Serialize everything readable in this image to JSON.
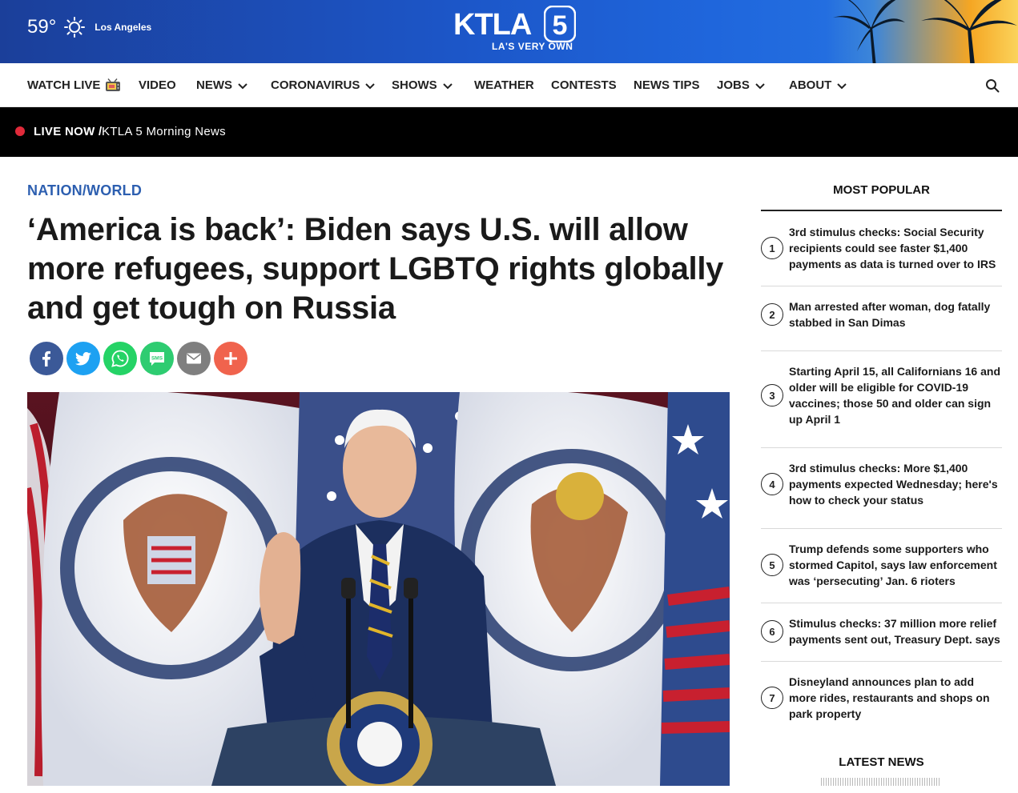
{
  "header": {
    "temperature": "59°",
    "weather_icon": "sun-icon",
    "city": "Los Angeles",
    "logo_text": "KTLA",
    "logo_number": "5",
    "tagline": "LA'S VERY OWN"
  },
  "nav": {
    "items": [
      {
        "label": "WATCH LIVE",
        "icon": "tv-icon"
      },
      {
        "label": "VIDEO"
      },
      {
        "label": "NEWS",
        "icon": "chevron-down-icon"
      },
      {
        "label": "CORONAVIRUS",
        "icon": "chevron-down-icon"
      },
      {
        "label": "SHOWS",
        "icon": "chevron-down-icon"
      },
      {
        "label": "WEATHER"
      },
      {
        "label": "CONTESTS"
      },
      {
        "label": "NEWS TIPS"
      },
      {
        "label": "JOBS",
        "icon": "chevron-down-icon"
      },
      {
        "label": "ABOUT",
        "icon": "chevron-down-icon"
      }
    ],
    "search_icon": "search-icon"
  },
  "live": {
    "label": "LIVE NOW /",
    "show": "KTLA 5 Morning News"
  },
  "article": {
    "category": "NATION/WORLD",
    "headline": "‘America is back’: Biden says U.S. will allow more refugees, support LGBTQ rights globally and get tough on Russia",
    "share_buttons": [
      {
        "name": "facebook-icon",
        "color": "#3b5998"
      },
      {
        "name": "twitter-icon",
        "color": "#1da1f2"
      },
      {
        "name": "whatsapp-icon",
        "color": "#25d366"
      },
      {
        "name": "sms-icon",
        "color": "#2ecc71"
      },
      {
        "name": "email-icon",
        "color": "#7f7f7f"
      },
      {
        "name": "more-icon",
        "color": "#f0634d"
      }
    ]
  },
  "sidebar": {
    "most_popular_title": "MOST POPULAR",
    "items": [
      {
        "num": "1",
        "text": "3rd stimulus checks: Social Security recipients could see faster $1,400 payments as data is turned over to IRS"
      },
      {
        "num": "2",
        "text": "Man arrested after woman, dog fatally stabbed in San Dimas"
      },
      {
        "num": "3",
        "text": "Starting April 15, all Californians 16 and older will be eligible for COVID-19 vaccines; those 50 and older can sign up April 1"
      },
      {
        "num": "4",
        "text": "3rd stimulus checks: More $1,400 payments expected Wednesday; here's how to check your status"
      },
      {
        "num": "5",
        "text": "Trump defends some supporters who stormed Capitol, says law enforcement was ‘persecuting’ Jan. 6 rioters"
      },
      {
        "num": "6",
        "text": "Stimulus checks: 37 million more relief payments sent out, Treasury Dept. says"
      },
      {
        "num": "7",
        "text": "Disneyland announces plan to add more rides, restaurants and shops on park property"
      }
    ],
    "latest_title": "LATEST NEWS"
  },
  "colors": {
    "brand_blue": "#1c56c8",
    "category_blue": "#2d5fb0",
    "live_red": "#e02a3a"
  }
}
